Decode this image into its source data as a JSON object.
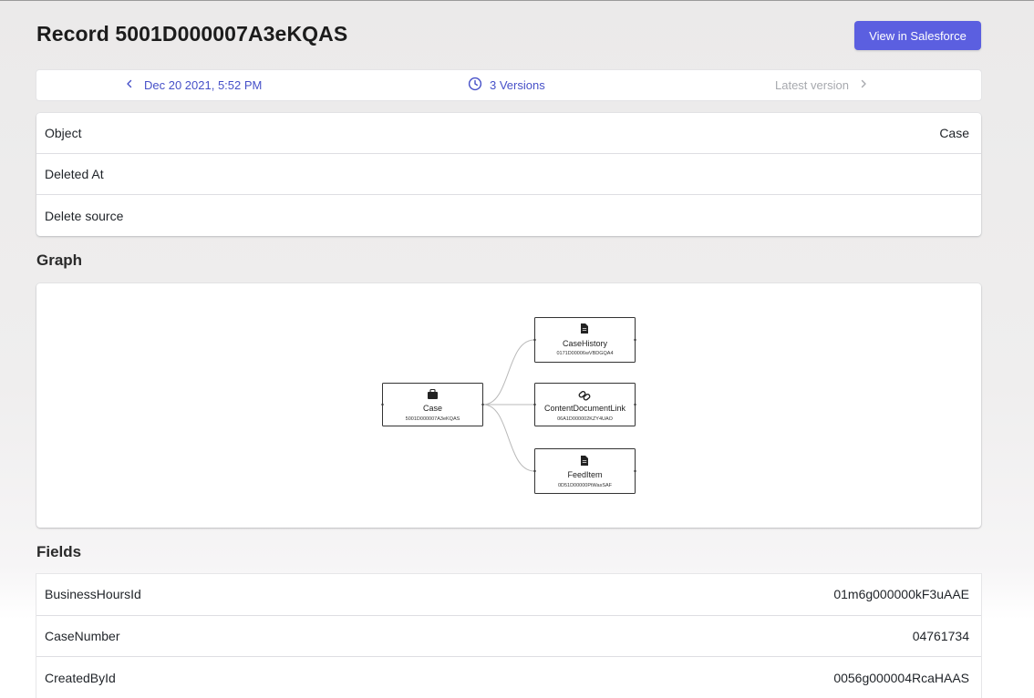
{
  "header": {
    "title": "Record 5001D000007A3eKQAS",
    "view_button_label": "View in Salesforce"
  },
  "version_bar": {
    "previous_label": "Dec 20 2021, 5:52 PM",
    "versions_label": "3 Versions",
    "next_label": "Latest version"
  },
  "meta": {
    "rows": [
      {
        "label": "Object",
        "value": "Case"
      },
      {
        "label": "Deleted At",
        "value": ""
      },
      {
        "label": "Delete source",
        "value": ""
      }
    ]
  },
  "graph": {
    "section_title": "Graph",
    "nodes": {
      "root": {
        "name": "Case",
        "id": "5001D000007A3eKQAS",
        "icon": "briefcase-icon"
      },
      "children": [
        {
          "name": "CaseHistory",
          "id": "0171D00006wVBDGQA4",
          "icon": "document-icon"
        },
        {
          "name": "ContentDocumentLink",
          "id": "06A1D000002KZY4UAO",
          "icon": "link-icon"
        },
        {
          "name": "FeedItem",
          "id": "0D51D00000PtWasSAF",
          "icon": "document-icon"
        }
      ]
    }
  },
  "fields": {
    "section_title": "Fields",
    "rows": [
      {
        "label": "BusinessHoursId",
        "value": "01m6g000000kF3uAAE"
      },
      {
        "label": "CaseNumber",
        "value": "04761734"
      },
      {
        "label": "CreatedById",
        "value": "0056g000004RcaHAAS"
      }
    ]
  },
  "colors": {
    "accent": "#5b5fe0",
    "link": "#4650c8",
    "muted": "#a7a9ae"
  }
}
